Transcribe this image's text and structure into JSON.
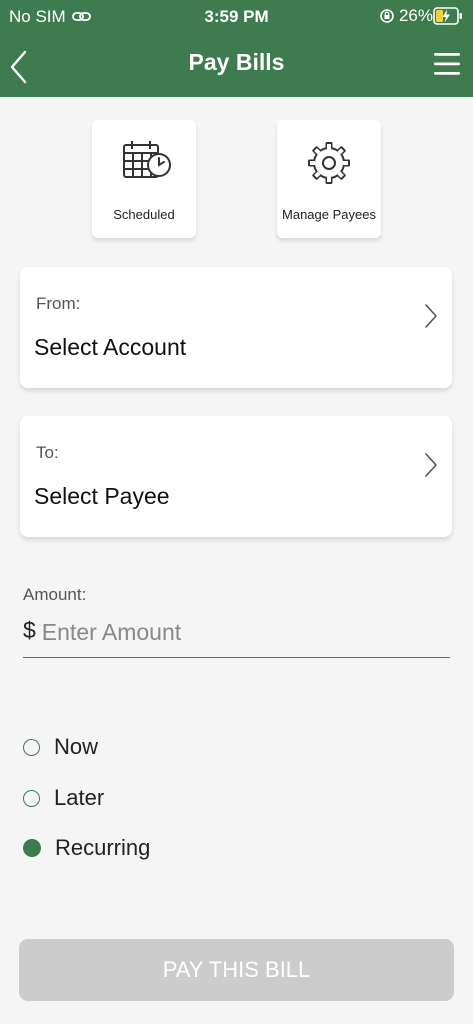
{
  "status_bar": {
    "carrier": "No SIM",
    "time": "3:59 PM",
    "battery": "26%"
  },
  "header": {
    "title": "Pay Bills"
  },
  "quick_actions": [
    {
      "label": "Scheduled",
      "icon": "calendar-clock-icon"
    },
    {
      "label": "Manage Payees",
      "icon": "gear-icon"
    }
  ],
  "from_card": {
    "label": "From:",
    "value": "Select Account"
  },
  "to_card": {
    "label": "To:",
    "value": "Select Payee"
  },
  "amount": {
    "label": "Amount:",
    "currency": "$",
    "placeholder": "Enter Amount",
    "value": ""
  },
  "schedule_options": [
    {
      "label": "Now",
      "selected": false
    },
    {
      "label": "Later",
      "selected": false
    },
    {
      "label": "Recurring",
      "selected": true
    }
  ],
  "pay_button": {
    "label": "PAY THIS BILL",
    "enabled": false
  },
  "colors": {
    "brand_green": "#3e7b4f",
    "background": "#f5f5f5",
    "disabled_button": "#cccccc"
  }
}
